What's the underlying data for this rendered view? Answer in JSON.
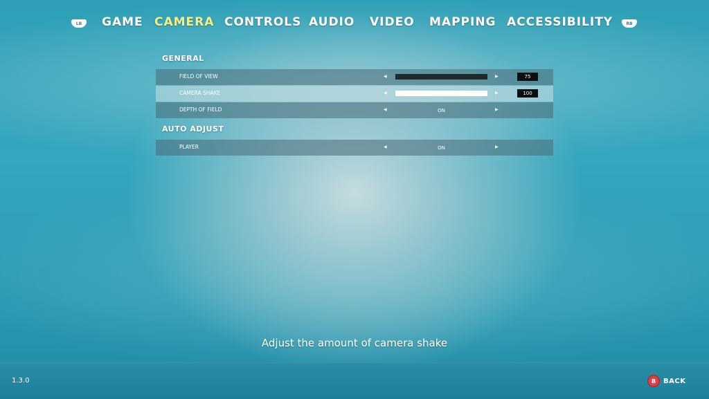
{
  "nav": {
    "left_bumper": "LB",
    "right_bumper": "RB",
    "tabs": [
      {
        "label": "GAME",
        "active": false
      },
      {
        "label": "CAMERA",
        "active": true
      },
      {
        "label": "CONTROLS",
        "active": false
      },
      {
        "label": "AUDIO",
        "active": false
      },
      {
        "label": "VIDEO",
        "active": false
      },
      {
        "label": "MAPPING",
        "active": false
      },
      {
        "label": "ACCESSIBILITY",
        "active": false
      }
    ],
    "active_color": "#f3f08a"
  },
  "sections": [
    {
      "title": "GENERAL",
      "rows": [
        {
          "label": "FIELD OF VIEW",
          "type": "slider",
          "value": "75",
          "fill_fraction": 0.0,
          "selected": false
        },
        {
          "label": "CAMERA SHAKE",
          "type": "slider",
          "value": "100",
          "fill_fraction": 1.0,
          "selected": true
        },
        {
          "label": "DEPTH OF FIELD",
          "type": "option",
          "value": "ON",
          "selected": false
        }
      ]
    },
    {
      "title": "AUTO ADJUST",
      "rows": [
        {
          "label": "PLAYER",
          "type": "option",
          "value": "ON",
          "selected": false
        }
      ]
    }
  ],
  "arrows": {
    "left": "◀",
    "right": "▶"
  },
  "description": "Adjust the amount of camera shake",
  "footer": {
    "version": "1.3.0",
    "back_button_glyph": "B",
    "back_label": "BACK",
    "back_color": "#d7434b"
  }
}
